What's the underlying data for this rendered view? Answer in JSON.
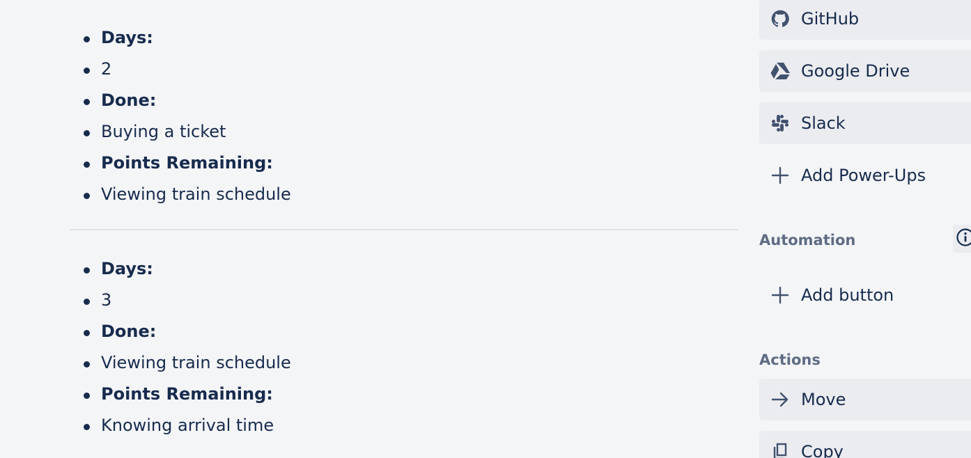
{
  "description": {
    "entries": [
      {
        "items": [
          {
            "text": "Days:",
            "bold": true
          },
          {
            "text": "2",
            "bold": false
          },
          {
            "text": "Done:",
            "bold": true
          },
          {
            "text": "Buying a ticket",
            "bold": false
          },
          {
            "text": "Points Remaining:",
            "bold": true
          },
          {
            "text": "Viewing train schedule",
            "bold": false
          }
        ]
      },
      {
        "items": [
          {
            "text": "Days:",
            "bold": true
          },
          {
            "text": "3",
            "bold": false
          },
          {
            "text": "Done:",
            "bold": true
          },
          {
            "text": "Viewing train schedule",
            "bold": false
          },
          {
            "text": "Points Remaining:",
            "bold": true
          },
          {
            "text": "Knowing arrival time",
            "bold": false
          }
        ]
      }
    ]
  },
  "sidebar": {
    "power_ups": {
      "github": {
        "label": "GitHub",
        "icon": "github-icon"
      },
      "google_drive": {
        "label": "Google Drive",
        "icon": "google-drive-icon"
      },
      "slack": {
        "label": "Slack",
        "icon": "slack-icon"
      },
      "add": {
        "label": "Add Power-Ups",
        "icon": "plus-icon"
      }
    },
    "automation": {
      "heading": "Automation",
      "info_icon": "info-icon",
      "add_button": {
        "label": "Add button",
        "icon": "plus-icon"
      }
    },
    "actions": {
      "heading": "Actions",
      "move": {
        "label": "Move",
        "icon": "arrow-right-icon"
      },
      "copy": {
        "label": "Copy",
        "icon": "copy-icon"
      }
    }
  },
  "colors": {
    "background": "#f4f5f7",
    "text": "#172b4d",
    "muted_heading": "#5e6c84",
    "button_bg": "#ebecf0",
    "divider": "#dfe1e6"
  }
}
